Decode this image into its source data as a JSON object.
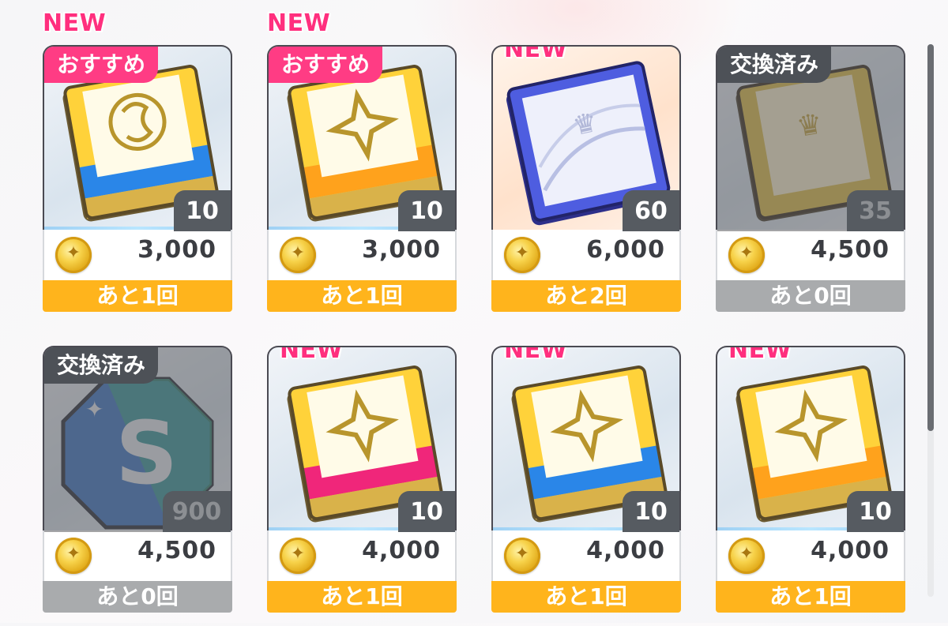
{
  "shop": {
    "items": [
      {
        "new": "NEW",
        "ribbon": "おすすめ",
        "quantity": "10",
        "price": "3,000",
        "remaining": "あと1回",
        "art": "book-yellow-blue",
        "currency": "gold-coin"
      },
      {
        "new": "NEW",
        "ribbon": "おすすめ",
        "quantity": "10",
        "price": "3,000",
        "remaining": "あと1回",
        "art": "book-yellow-orange",
        "currency": "gold-coin"
      },
      {
        "new": "NEW",
        "ribbon": "",
        "quantity": "60",
        "price": "6,000",
        "remaining": "あと2回",
        "art": "book-blue-silver",
        "currency": "gold-coin"
      },
      {
        "new": "",
        "ribbon": "交換済み",
        "quantity": "35",
        "price": "4,500",
        "remaining": "あと0回",
        "art": "book-gold-exchanged",
        "currency": "gold-coin"
      },
      {
        "new": "",
        "ribbon": "交換済み",
        "quantity": "900",
        "price": "4,500",
        "remaining": "あと0回",
        "art": "s-octagon-exchanged",
        "currency": "gold-coin"
      },
      {
        "new": "NEW",
        "ribbon": "",
        "quantity": "10",
        "price": "4,000",
        "remaining": "あと1回",
        "art": "book-yellow-pink",
        "currency": "gold-coin"
      },
      {
        "new": "NEW",
        "ribbon": "",
        "quantity": "10",
        "price": "4,000",
        "remaining": "あと1回",
        "art": "book-yellow-blue",
        "currency": "gold-coin"
      },
      {
        "new": "NEW",
        "ribbon": "",
        "quantity": "10",
        "price": "4,000",
        "remaining": "あと1回",
        "art": "book-yellow-orange",
        "currency": "gold-coin"
      }
    ],
    "octagon_letter": "S"
  },
  "colors": {
    "new": "#ff2f7e",
    "recommend_ribbon": "#ff3c84",
    "exchanged_ribbon": "#4d5157",
    "remaining_available": "#ffb41c",
    "remaining_none": "#a9abad"
  }
}
